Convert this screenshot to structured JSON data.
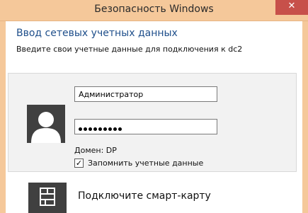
{
  "window": {
    "title": "Безопасность Windows",
    "close_glyph": "✕"
  },
  "dialog": {
    "heading": "Ввод сетевых учетных данных",
    "subheading": "Введите свои учетные данные для подключения к dc2"
  },
  "credentials": {
    "avatar_icon": "user-avatar-icon",
    "username_value": "Администратор",
    "password_masked_length": 9,
    "domain_label": "Домен: DP",
    "remember_label": "Запомнить учетные данные",
    "remember_checked": true,
    "check_glyph": "✓"
  },
  "smartcard": {
    "icon": "smart-card-icon",
    "label": "Подключите смарт-карту"
  },
  "colors": {
    "titlebar": "#f5c89a",
    "close_button": "#c7504a",
    "heading": "#1f4f8b",
    "avatar_bg": "#404040"
  }
}
